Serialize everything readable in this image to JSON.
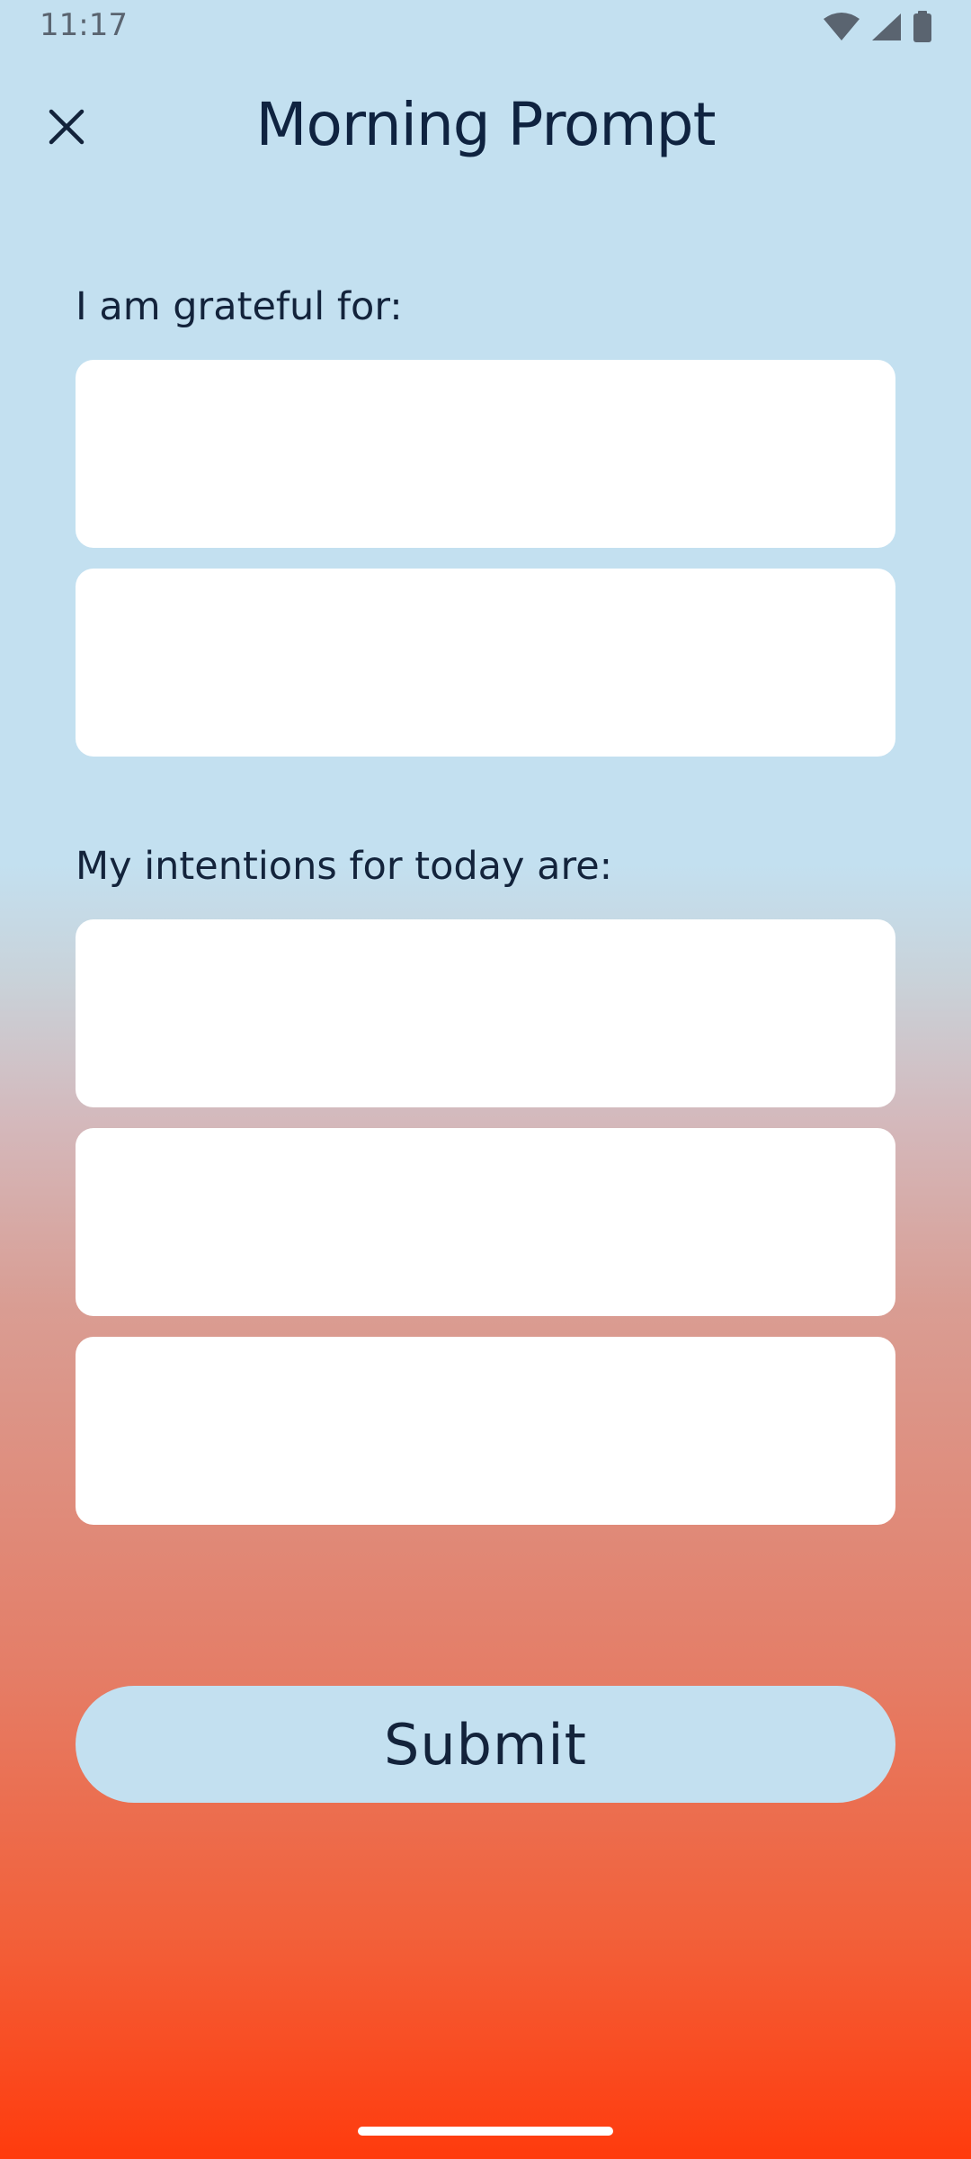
{
  "status_bar": {
    "time": "11:17",
    "icons": [
      "wifi-icon",
      "cellular-signal-icon",
      "battery-icon"
    ]
  },
  "header": {
    "title": "Morning Prompt",
    "close_icon": "close-icon"
  },
  "gratitude": {
    "label": "I am grateful for:",
    "entries": [
      {
        "value": "",
        "placeholder": ""
      },
      {
        "value": "",
        "placeholder": ""
      }
    ]
  },
  "intentions": {
    "label": "My intentions for today are:",
    "entries": [
      {
        "value": "",
        "placeholder": ""
      },
      {
        "value": "",
        "placeholder": ""
      },
      {
        "value": "",
        "placeholder": ""
      }
    ]
  },
  "actions": {
    "submit_label": "Submit"
  },
  "colors": {
    "title_text": "#0f2340",
    "background_top": "#c3e0f0",
    "background_bottom": "#ff3b0d",
    "field_background": "#ffffff",
    "submit_background": "#c3e0f0"
  }
}
